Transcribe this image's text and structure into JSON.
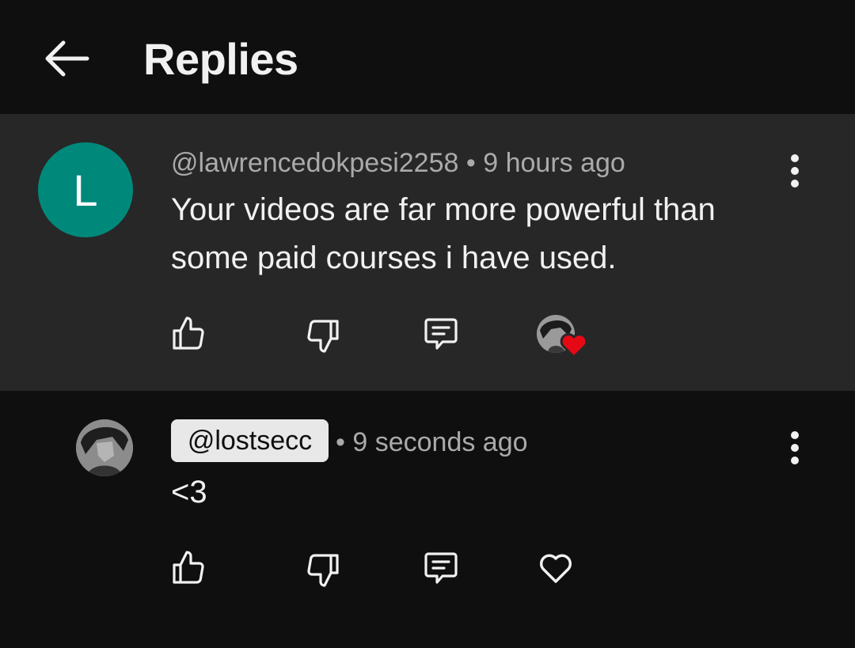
{
  "header": {
    "title": "Replies",
    "back_icon": "arrow-left-icon"
  },
  "parent_comment": {
    "avatar_letter": "L",
    "avatar_color": "#00897b",
    "handle": "@lawrencedokpesi2258",
    "separator": "•",
    "time": "9 hours ago",
    "text_line1": "Your videos are far more powerful than",
    "text_line2": "some paid courses i have used.",
    "actions": [
      "thumbs-up-icon",
      "thumbs-down-icon",
      "reply-icon",
      "creator-heart-icon"
    ],
    "creator_heart_color": "#e50914"
  },
  "reply": {
    "handle": "@lostsecc",
    "separator": "•",
    "time": "9 seconds ago",
    "text": "<3",
    "actions": [
      "thumbs-up-icon",
      "thumbs-down-icon",
      "reply-icon",
      "heart-icon"
    ]
  },
  "colors": {
    "background": "#0f0f0f",
    "highlight_row": "#272727",
    "text_primary": "#f1f1f1",
    "text_secondary": "#aaaaaa"
  }
}
